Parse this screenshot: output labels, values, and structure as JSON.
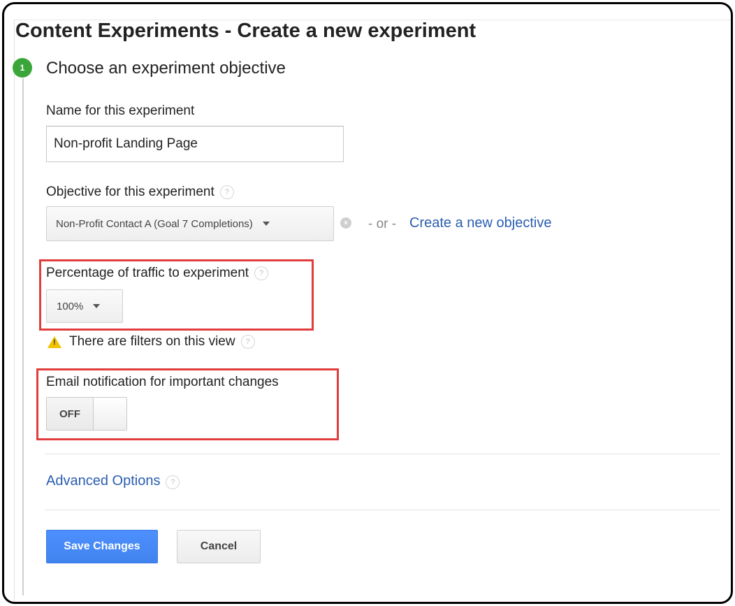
{
  "page": {
    "title": "Content Experiments - Create a new experiment"
  },
  "step": {
    "number": "1",
    "title": "Choose an experiment objective"
  },
  "name_field": {
    "label": "Name for this experiment",
    "value": "Non-profit Landing Page"
  },
  "objective": {
    "label": "Objective for this experiment",
    "selected": "Non-Profit Contact A (Goal 7 Completions)",
    "or_text": "- or -",
    "create_link": "Create a new objective"
  },
  "traffic": {
    "label": "Percentage of traffic to experiment",
    "selected": "100%"
  },
  "filter_warning": {
    "text": "There are filters on this view"
  },
  "email_notification": {
    "label": "Email notification for important changes",
    "state": "OFF"
  },
  "advanced": {
    "label": "Advanced Options"
  },
  "actions": {
    "save_label": "Save Changes",
    "cancel_label": "Cancel"
  },
  "icons": {
    "help": "?",
    "clear": "×",
    "warning": "!"
  },
  "colors": {
    "step_green": "#3aa63a",
    "link_blue": "#2a5db0",
    "primary_button": "#4d90fe",
    "highlight_red": "#e23d3d"
  }
}
